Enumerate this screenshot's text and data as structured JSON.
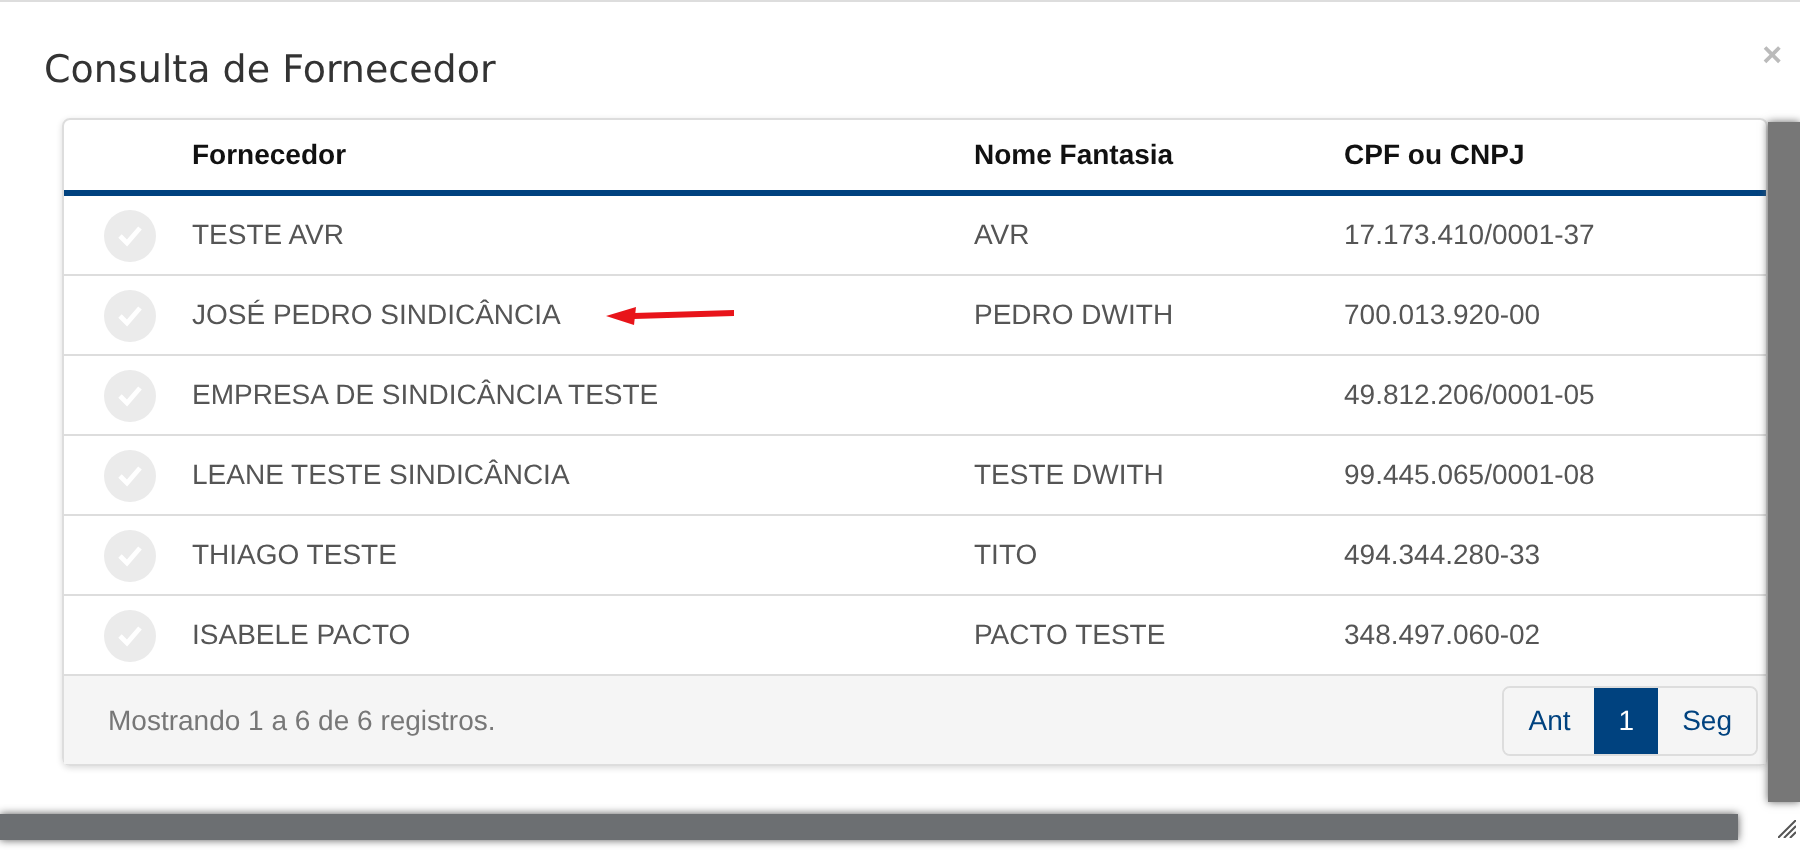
{
  "modal": {
    "title": "Consulta de Fornecedor",
    "close": "×"
  },
  "table": {
    "columns": [
      "Fornecedor",
      "Nome Fantasia",
      "CPF ou CNPJ"
    ],
    "rows": [
      {
        "fornecedor": "TESTE AVR",
        "nome_fantasia": "AVR",
        "cpf_cnpj": "17.173.410/0001-37",
        "selected": false
      },
      {
        "fornecedor": "JOSÉ PEDRO SINDICÂNCIA",
        "nome_fantasia": "PEDRO DWITH",
        "cpf_cnpj": "700.013.920-00",
        "selected": false,
        "marked": true
      },
      {
        "fornecedor": "EMPRESA DE SINDICÂNCIA TESTE",
        "nome_fantasia": "",
        "cpf_cnpj": "49.812.206/0001-05",
        "selected": false
      },
      {
        "fornecedor": "LEANE TESTE SINDICÂNCIA",
        "nome_fantasia": "TESTE DWITH",
        "cpf_cnpj": "99.445.065/0001-08",
        "selected": false
      },
      {
        "fornecedor": "THIAGO TESTE",
        "nome_fantasia": "TITO",
        "cpf_cnpj": "494.344.280-33",
        "selected": false
      },
      {
        "fornecedor": "ISABELE PACTO",
        "nome_fantasia": "PACTO TESTE",
        "cpf_cnpj": "348.497.060-02",
        "selected": false
      }
    ]
  },
  "footer": {
    "info": "Mostrando 1 a 6 de 6 registros.",
    "pagination": [
      {
        "label": "Ant",
        "selected": false
      },
      {
        "label": "1",
        "selected": true
      },
      {
        "label": "Seg",
        "selected": false
      }
    ]
  }
}
